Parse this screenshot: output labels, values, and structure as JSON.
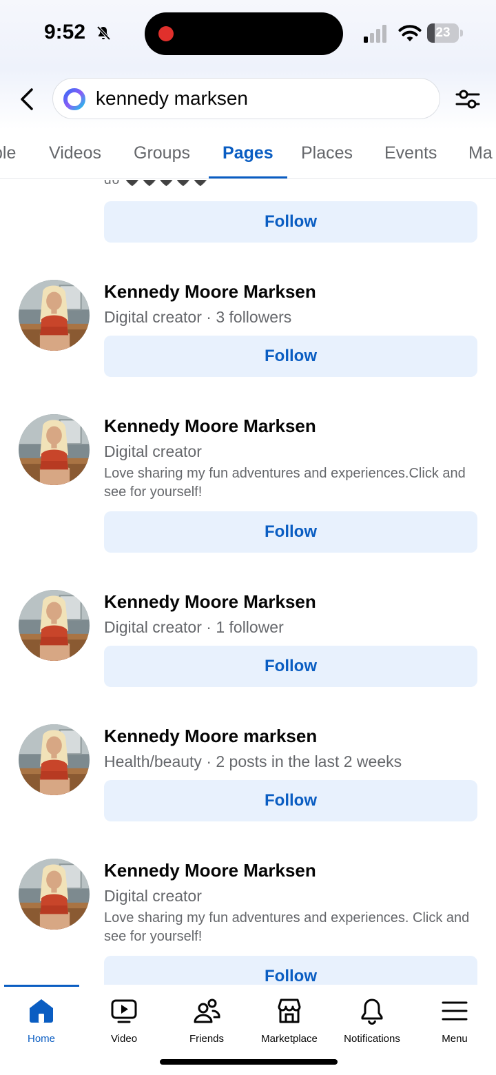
{
  "status_bar": {
    "time": "9:52",
    "battery": "23",
    "battery_level": 0.23
  },
  "search": {
    "query": "kennedy marksen",
    "icons": [
      "back-arrow-icon",
      "meta-ai-ring-icon",
      "filter-sliders-icon"
    ]
  },
  "tabs": {
    "items": [
      "ple",
      "Videos",
      "Groups",
      "Pages",
      "Places",
      "Events",
      "Ma"
    ],
    "active": "Pages"
  },
  "results": {
    "partial_snippet": "do 🖤🖤🖤🖤🖤",
    "follow_label": "Follow",
    "items": [
      {
        "name": "Kennedy Moore Marksen",
        "meta": "Digital creator · 3 followers",
        "description": ""
      },
      {
        "name": "Kennedy Moore Marksen",
        "meta": "Digital creator",
        "description": "Love sharing my fun adventures and experiences.Click and see for yourself!"
      },
      {
        "name": "Kennedy Moore Marksen",
        "meta": "Digital creator · 1 follower",
        "description": ""
      },
      {
        "name": "Kennedy Moore marksen",
        "meta": "Health/beauty · 2 posts in the last 2 weeks",
        "description": ""
      },
      {
        "name": "Kennedy Moore Marksen",
        "meta": "Digital creator",
        "description": "Love sharing my fun adventures and experiences. Click and see for yourself!"
      }
    ]
  },
  "bottom_nav": {
    "items": [
      {
        "label": "Home",
        "icon": "home-icon",
        "active": true
      },
      {
        "label": "Video",
        "icon": "video-icon",
        "active": false
      },
      {
        "label": "Friends",
        "icon": "friends-icon",
        "active": false
      },
      {
        "label": "Marketplace",
        "icon": "marketplace-icon",
        "active": false
      },
      {
        "label": "Notifications",
        "icon": "bell-icon",
        "active": false
      },
      {
        "label": "Menu",
        "icon": "menu-icon",
        "active": false
      }
    ]
  },
  "colors": {
    "accent": "#0a5dc2",
    "button_bg": "#e8f1fd",
    "secondary_text": "#65676b"
  }
}
